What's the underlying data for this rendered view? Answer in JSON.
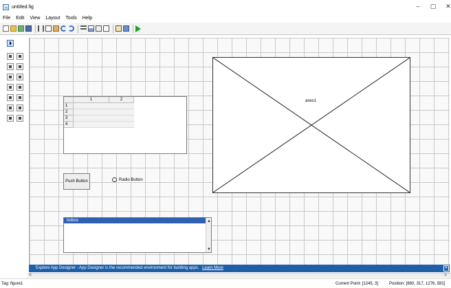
{
  "window": {
    "title": "untitled.fig",
    "minimize_glyph": "–",
    "maximize_glyph": "▢",
    "close_glyph": "✕"
  },
  "menu": [
    "File",
    "Edit",
    "View",
    "Layout",
    "Tools",
    "Help"
  ],
  "toolbar": [
    "new-icon",
    "open-icon",
    "edit-icon",
    "save-icon",
    "cut-icon",
    "copy-icon",
    "paste-icon",
    "undo-icon",
    "redo-icon",
    "align-icon",
    "menu-editor-icon",
    "tab-order-icon",
    "editor-icon",
    "property-inspector-icon",
    "object-browser-icon",
    "run-icon"
  ],
  "palette": [
    "select-icon",
    "push-button-icon",
    "slider-icon",
    "radio-button-icon",
    "checkbox-icon",
    "edit-text-icon",
    "static-text-icon",
    "popup-menu-icon",
    "listbox-icon",
    "toggle-button-icon",
    "table-icon",
    "axes-icon",
    "panel-icon",
    "button-group-icon",
    "activex-icon"
  ],
  "table": {
    "columns": [
      "1",
      "2"
    ],
    "rows": [
      "1",
      "2",
      "3",
      "4"
    ]
  },
  "push_button": {
    "label": "Push Button"
  },
  "radio_button": {
    "label": "Radio Button"
  },
  "axes": {
    "label": "axes1"
  },
  "listbox": {
    "selected": "listbox",
    "up_arrow": "▲",
    "down_arrow": "▼"
  },
  "scroll": {
    "left": "<",
    "right": ">"
  },
  "banner": {
    "text": "Explore App Designer - App Designer is the recommended environment for building apps.",
    "link": "Learn More",
    "close": "✕"
  },
  "status": {
    "tag": "Tag: figure1",
    "current_point": "Current Point: [1245, 3]",
    "position": "Position: [680, 317, 1276, 581]"
  }
}
